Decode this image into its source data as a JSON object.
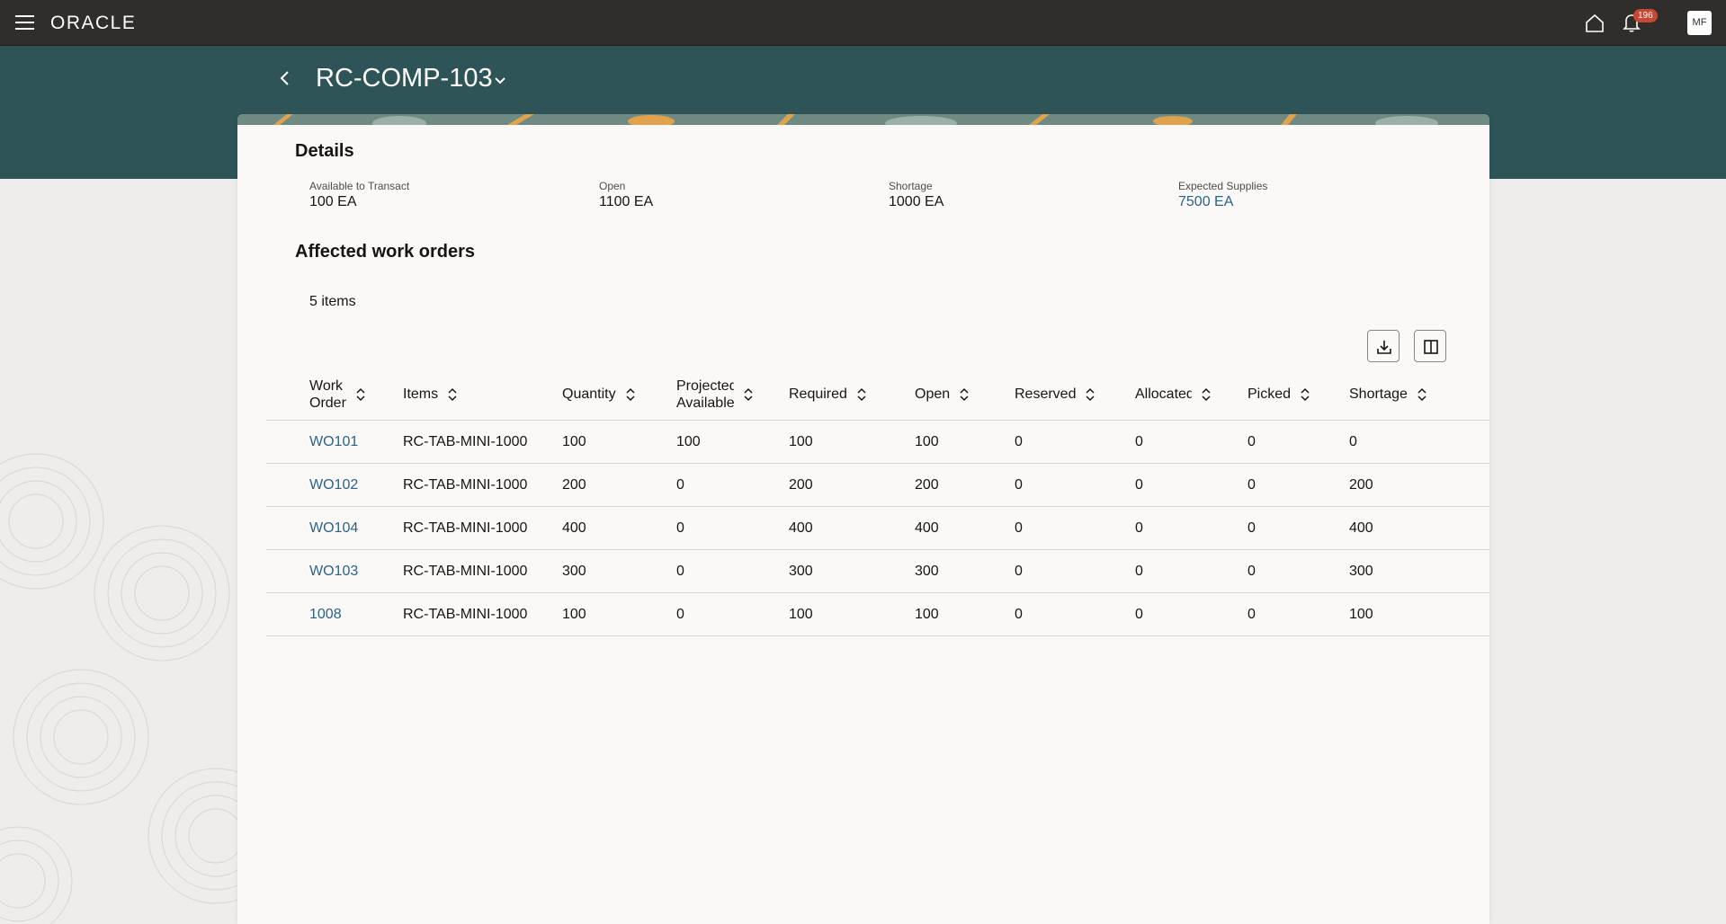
{
  "topbar": {
    "logo": "ORACLE",
    "notification_count": "196",
    "avatar_initials": "MF"
  },
  "header": {
    "title": "RC-COMP-103"
  },
  "details": {
    "section_title": "Details",
    "fields": [
      {
        "label": "Available to Transact",
        "value": "100 EA"
      },
      {
        "label": "Open",
        "value": "1100 EA"
      },
      {
        "label": "Shortage",
        "value": "1000 EA"
      },
      {
        "label": "Expected Supplies",
        "value": "7500 EA"
      }
    ]
  },
  "work_orders": {
    "section_title": "Affected work orders",
    "items_count": "5 items",
    "columns": [
      {
        "line1": "Work",
        "line2": "Order"
      },
      {
        "line1": "Items",
        "line2": ""
      },
      {
        "line1": "Quantity",
        "line2": ""
      },
      {
        "line1": "Projected",
        "line2": "Available"
      },
      {
        "line1": "Required",
        "line2": ""
      },
      {
        "line1": "Open",
        "line2": ""
      },
      {
        "line1": "Reserved",
        "line2": ""
      },
      {
        "line1": "Allocated",
        "line2": ""
      },
      {
        "line1": "Picked",
        "line2": ""
      },
      {
        "line1": "Shortage",
        "line2": ""
      }
    ],
    "rows": [
      [
        "WO101",
        "RC-TAB-MINI-1000",
        "100",
        "100",
        "100",
        "100",
        "0",
        "0",
        "0",
        "0"
      ],
      [
        "WO102",
        "RC-TAB-MINI-1000",
        "200",
        "0",
        "200",
        "200",
        "0",
        "0",
        "0",
        "200"
      ],
      [
        "WO104",
        "RC-TAB-MINI-1000",
        "400",
        "0",
        "400",
        "400",
        "0",
        "0",
        "0",
        "400"
      ],
      [
        "WO103",
        "RC-TAB-MINI-1000",
        "300",
        "0",
        "300",
        "300",
        "0",
        "0",
        "0",
        "300"
      ],
      [
        "1008",
        "RC-TAB-MINI-1000",
        "100",
        "0",
        "100",
        "100",
        "0",
        "0",
        "0",
        "100"
      ]
    ]
  },
  "colors": {
    "topbar": "#312d2a",
    "header_band": "#2e5458",
    "link": "#2b6288",
    "badge": "#c74634"
  }
}
